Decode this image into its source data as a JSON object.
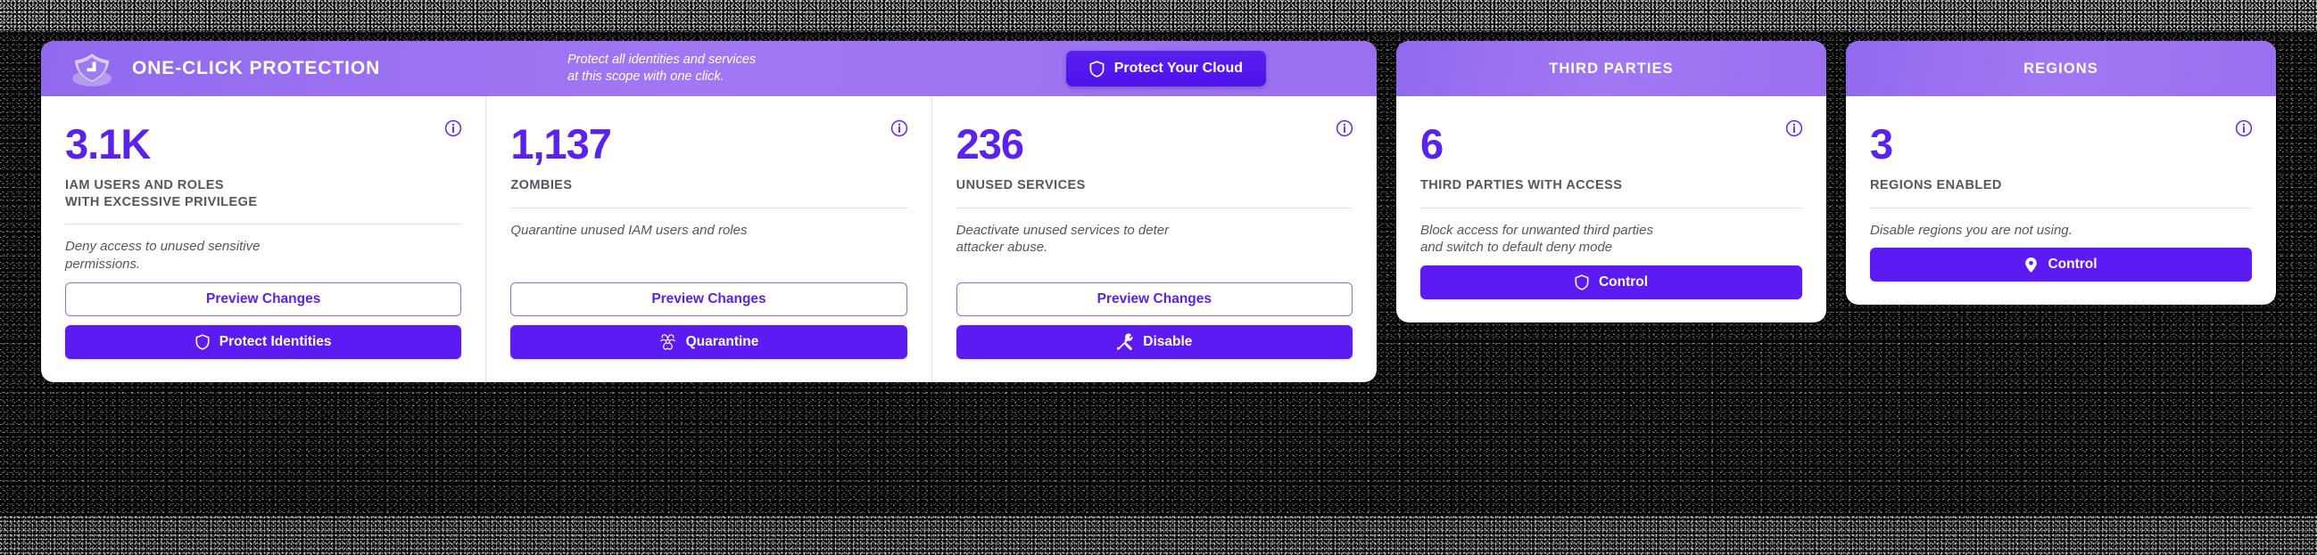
{
  "theme": {
    "accent": "#5B21EE",
    "accent_solid_button": "#5B1BF2",
    "header_gradient_light": "#A078F4",
    "header_gradient_dark": "#9169EE",
    "card_background": "#FFFFFF",
    "page_background": "#050505",
    "label_gray": "#56565C",
    "divider_gray": "#DCDCE0"
  },
  "one_click_card": {
    "brand": {
      "logo_icon": "shield-3d-icon",
      "title": "ONE-CLICK PROTECTION"
    },
    "tagline": "Protect all identities and services\nat this scope with one click.",
    "protect_cloud_button": {
      "label": "Protect Your Cloud",
      "icon": "shield-icon"
    },
    "metrics": [
      {
        "value": "3.1K",
        "label": "IAM USERS AND ROLES\nWITH EXCESSIVE PRIVILEGE",
        "description": "Deny access to unused sensitive\npermissions.",
        "info_icon": "info-circle-icon",
        "secondary_button": {
          "label": "Preview Changes"
        },
        "primary_button": {
          "label": "Protect Identities",
          "icon": "shield-icon"
        }
      },
      {
        "value": "1,137",
        "label": "ZOMBIES",
        "description": "Quarantine unused IAM users and roles",
        "info_icon": "info-circle-icon",
        "secondary_button": {
          "label": "Preview Changes"
        },
        "primary_button": {
          "label": "Quarantine",
          "icon": "biohazard-icon"
        }
      },
      {
        "value": "236",
        "label": "UNUSED SERVICES",
        "description": "Deactivate unused services to deter\nattacker abuse.",
        "info_icon": "info-circle-icon",
        "secondary_button": {
          "label": "Preview Changes"
        },
        "primary_button": {
          "label": "Disable",
          "icon": "tools-icon"
        }
      }
    ]
  },
  "side_cards": [
    {
      "title": "THIRD PARTIES",
      "value": "6",
      "label": "THIRD PARTIES WITH ACCESS",
      "description": "Block access for unwanted third parties\nand switch to default deny mode",
      "info_icon": "info-circle-icon",
      "primary_button": {
        "label": "Control",
        "icon": "shield-icon"
      }
    },
    {
      "title": "REGIONS",
      "value": "3",
      "label": "REGIONS ENABLED",
      "description": "Disable regions you are not using.",
      "info_icon": "info-circle-icon",
      "primary_button": {
        "label": "Control",
        "icon": "map-pin-icon"
      }
    }
  ]
}
